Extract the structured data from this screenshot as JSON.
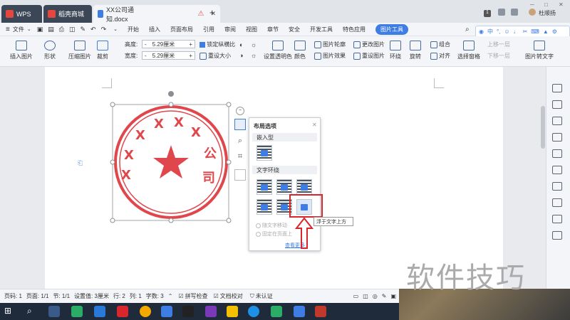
{
  "tabs": {
    "wps": "WPS",
    "store": "稻壳商城",
    "doc": "XX公司通知.docx",
    "add": "+"
  },
  "titlebar": {
    "user": "杜顺扬",
    "badge": "1"
  },
  "menu": {
    "file": "文件",
    "items": [
      "开始",
      "插入",
      "页面布局",
      "引用",
      "审阅",
      "视图",
      "章节",
      "安全",
      "开发工具",
      "特色应用"
    ],
    "active": "图片工具"
  },
  "ime": {
    "lang": "中"
  },
  "toolbar": {
    "insert_image": "插入图片",
    "shape": "形状",
    "compress": "压缩图片",
    "crop": "裁剪",
    "height_label": "高度:",
    "height_value": "5.29厘米",
    "width_label": "宽度:",
    "width_value": "5.29厘米",
    "lock_ratio": "锁定纵横比",
    "reset_size": "重设大小",
    "set_transparent": "设置透明色",
    "color": "颜色",
    "outline": "图片轮廓",
    "effects": "图片效果",
    "change_image": "更改图片",
    "reset_image": "重设图片",
    "wrap": "环绕",
    "rotate": "旋转",
    "group": "组合",
    "align": "对齐",
    "selection_pane": "选择窗格",
    "bring_forward": "上移一层",
    "send_backward": "下移一层",
    "to_text": "图片转文字"
  },
  "layout_panel": {
    "title": "布局选项",
    "inline_section": "嵌入型",
    "wrap_section": "文字环绕",
    "move_with_text": "随文字移动",
    "fix_on_page": "固定在页面上",
    "view_more": "查看更多",
    "tooltip": "浮于文字上方"
  },
  "status": {
    "page_num": "页码: 1",
    "page": "页面: 1/1",
    "section": "节: 1/1",
    "setting": "设置值: 3厘米",
    "row": "行: 2",
    "col": "列: 1",
    "words": "字数: 3",
    "spell": "拼写检查",
    "proof": "文档校对",
    "cert": "未认证"
  },
  "watermark": "软件技巧",
  "colors": {
    "accent": "#3d7de4",
    "stamp": "#e0474c",
    "highlight": "#d9262c"
  }
}
